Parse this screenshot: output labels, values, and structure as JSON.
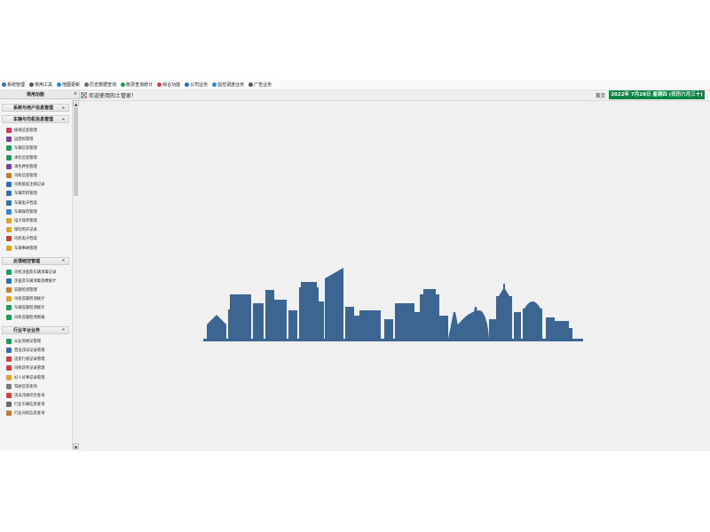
{
  "menubar": {
    "items": [
      {
        "label": "系统管理",
        "icon": "gear-icon",
        "color": "#3a6fb0"
      },
      {
        "label": "常用工具",
        "icon": "wrench-icon",
        "color": "#555555"
      },
      {
        "label": "地图更新",
        "icon": "globe-icon",
        "color": "#2e89d6"
      },
      {
        "label": "历史数据查询",
        "icon": "clock-icon",
        "color": "#6a6a6a"
      },
      {
        "label": "账票查询统计",
        "icon": "coin-icon",
        "color": "#1f9d55"
      },
      {
        "label": "综合功能",
        "icon": "grid-icon",
        "color": "#d23c3c"
      },
      {
        "label": "公司业务",
        "icon": "home-icon",
        "color": "#2f6fb3"
      },
      {
        "label": "监控调度业务",
        "icon": "monitor-icon",
        "color": "#2e89d6"
      },
      {
        "label": "广告业务",
        "icon": "cross-icon",
        "color": "#555555"
      }
    ]
  },
  "sidebar": {
    "title": "常用功能",
    "close_glyph": "×",
    "groups": [
      {
        "label": "系统与用户信息管理",
        "arrow": "»",
        "items": []
      },
      {
        "label": "车辆与司机信息管理",
        "arrow": "«",
        "items": [
          {
            "label": "核线信息管理",
            "color": "#d9365a"
          },
          {
            "label": "运营权管理",
            "color": "#8a3d9b"
          },
          {
            "label": "车辆信息管理",
            "color": "#1b9e5a"
          },
          {
            "label": "承包信息管理",
            "color": "#1b9e5a"
          },
          {
            "label": "承包押金管理",
            "color": "#7b3fa0"
          },
          {
            "label": "司机信息管理",
            "color": "#c77b2b"
          },
          {
            "label": "司机抵延注销记录",
            "color": "#2f6fb3"
          },
          {
            "label": "车辆年检管理",
            "color": "#2f6fb3"
          },
          {
            "label": "车辆电子档案",
            "color": "#2f6fb3"
          },
          {
            "label": "车辆保险管理",
            "color": "#2e89d6"
          },
          {
            "label": "电子保单管理",
            "color": "#e0a22b"
          },
          {
            "label": "保险购买记录",
            "color": "#e0a22b"
          },
          {
            "label": "司机电子档案",
            "color": "#c8402d"
          },
          {
            "label": "车辆事故管理",
            "color": "#d9a21b"
          }
        ]
      },
      {
        "label": "反馈结控管理",
        "arrow": "«",
        "items": [
          {
            "label": "司机涉盗及车辆消毒记录",
            "color": "#1b9e5a"
          },
          {
            "label": "涉盗及车辆消毒消费统计",
            "color": "#2f6fb3"
          },
          {
            "label": "答题检测管理",
            "color": "#c77b2b"
          },
          {
            "label": "司机答题检测统计",
            "color": "#e0a22b"
          },
          {
            "label": "车辆答题检测统计",
            "color": "#1b9e5a"
          },
          {
            "label": "司机答题检测周报",
            "color": "#1b9e5a"
          }
        ]
      },
      {
        "label": "行业平台业务",
        "arrow": "«",
        "items": [
          {
            "label": "从业资格证管理",
            "color": "#1b9e5a"
          },
          {
            "label": "营运违法记录管理",
            "color": "#2f6fb3"
          },
          {
            "label": "违反行规记录管理",
            "color": "#d23c3c"
          },
          {
            "label": "司机获奖记录管理",
            "color": "#d23c3c"
          },
          {
            "label": "好人好事记录管理",
            "color": "#e0a22b"
          },
          {
            "label": "驾驶信息查询",
            "color": "#7a7a7a"
          },
          {
            "label": "违法违规综合查询",
            "color": "#d23c3c"
          },
          {
            "label": "行业车辆信息查询",
            "color": "#6a6a6a"
          },
          {
            "label": "行业司机信息查询",
            "color": "#c77b2b"
          }
        ]
      }
    ]
  },
  "main": {
    "tab_title": "欢迎使用的士管家！",
    "home_label": "首页",
    "date_text": "2022年 7月28日 星期四 (农历六月三十)",
    "date_bg_color": "#0a8443",
    "skyline_color": "#3c6591"
  }
}
